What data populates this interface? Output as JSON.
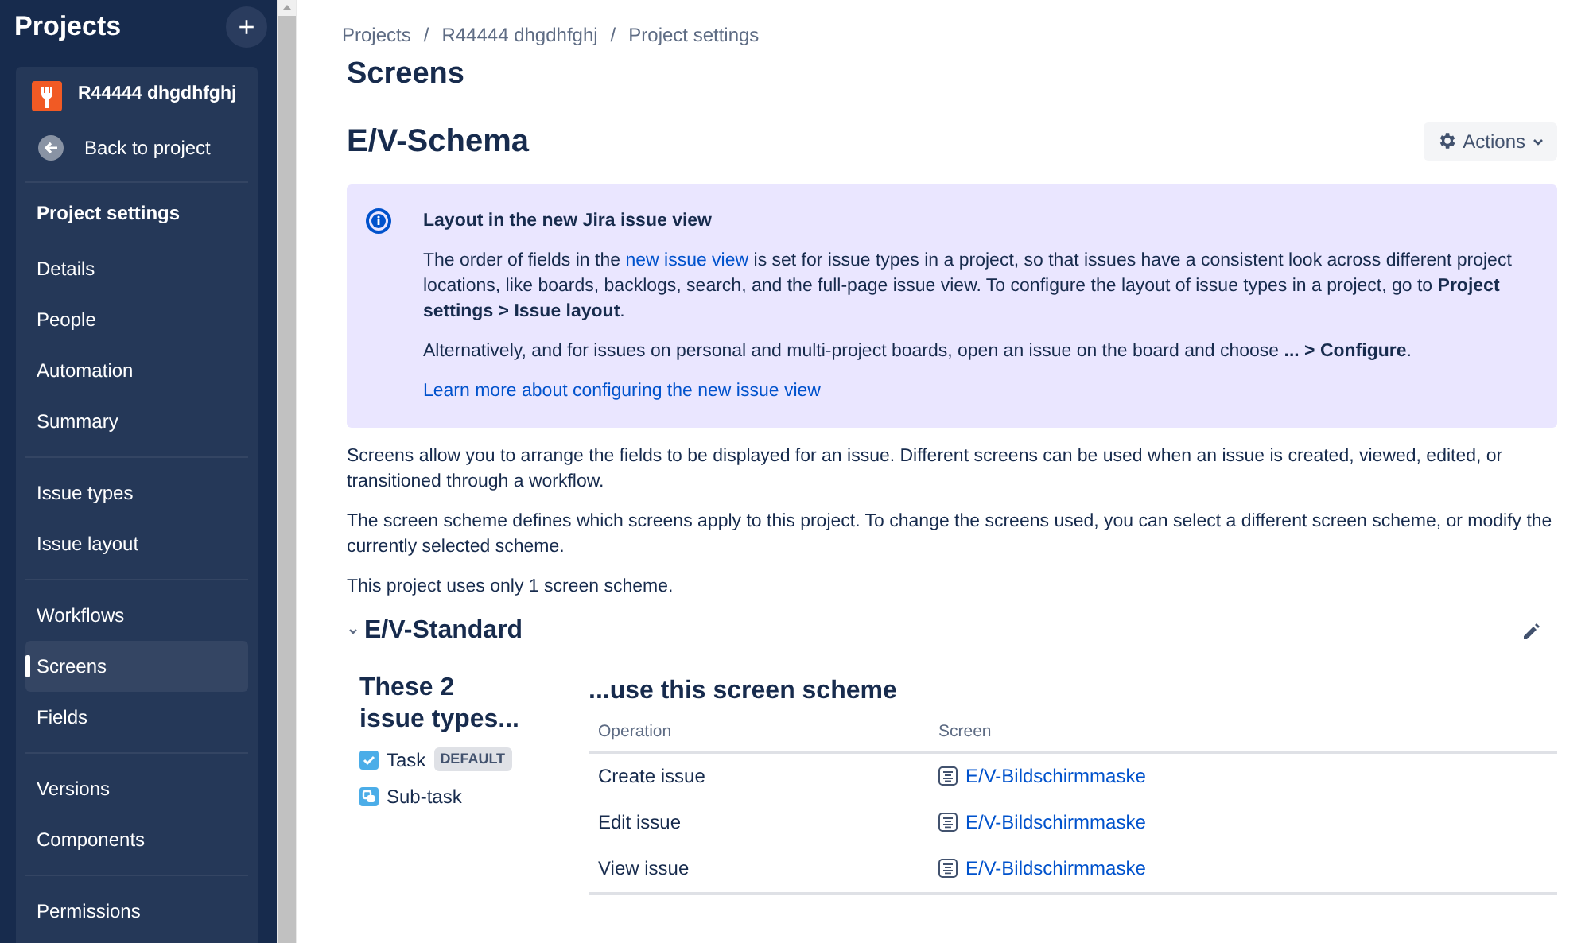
{
  "sidebar": {
    "title": "Projects",
    "add_button": "+",
    "project": {
      "name": "R44444 dhgdhfghj"
    },
    "back": "Back to project",
    "section": "Project settings",
    "groups": [
      [
        {
          "label": "Details",
          "selected": false
        },
        {
          "label": "People",
          "selected": false
        },
        {
          "label": "Automation",
          "selected": false
        },
        {
          "label": "Summary",
          "selected": false
        }
      ],
      [
        {
          "label": "Issue types",
          "selected": false
        },
        {
          "label": "Issue layout",
          "selected": false
        }
      ],
      [
        {
          "label": "Workflows",
          "selected": false
        },
        {
          "label": "Screens",
          "selected": true
        },
        {
          "label": "Fields",
          "selected": false
        }
      ],
      [
        {
          "label": "Versions",
          "selected": false
        },
        {
          "label": "Components",
          "selected": false
        }
      ],
      [
        {
          "label": "Permissions",
          "selected": false
        }
      ]
    ]
  },
  "breadcrumbs": [
    "Projects",
    "R44444 dhgdhfghj",
    "Project settings"
  ],
  "breadcrumb_separator": "/",
  "page_title": "Screens",
  "scheme_title": "E/V-Schema",
  "actions_button": "Actions",
  "info_panel": {
    "title": "Layout in the new Jira issue view",
    "paragraphs": [
      [
        {
          "kind": "text",
          "text": "The order of fields in the "
        },
        {
          "kind": "link",
          "text": "new issue view"
        },
        {
          "kind": "text",
          "text": " is set for issue types in a project, so that issues have a consistent look across different project locations, like boards, backlogs, search, and the full-page issue view. To configure the layout of issue types in a project, go to **Project settings > Issue layout**."
        }
      ],
      [
        {
          "kind": "text",
          "text": "Alternatively, and for issues on personal and multi-project boards, open an issue on the board and choose **... > Configure**."
        }
      ]
    ],
    "link": "Learn more about configuring the new issue view"
  },
  "description": [
    "Screens allow you to arrange the fields to be displayed for an issue. Different screens can be used when an issue is created, viewed, edited, or transitioned through a workflow.",
    "The screen scheme defines which screens apply to this project. To change the screens used, you can select a different screen scheme, or modify the currently selected scheme.",
    "This project uses only 1 screen scheme."
  ],
  "screen_scheme": {
    "name": "E/V-Standard",
    "expanded": true,
    "issue_types_heading": "These 2 issue types...",
    "issue_types": [
      {
        "kind": "task",
        "name": "Task",
        "badge": "DEFAULT"
      },
      {
        "kind": "subtask",
        "name": "Sub-task"
      }
    ],
    "table_heading": "...use this screen scheme",
    "columns": [
      "Operation",
      "Screen"
    ],
    "rows": [
      {
        "operation": "Create issue",
        "screen": "E/V-Bildschirmmaske"
      },
      {
        "operation": "Edit issue",
        "screen": "E/V-Bildschirmmaske"
      },
      {
        "operation": "View issue",
        "screen": "E/V-Bildschirmmaske"
      }
    ]
  }
}
